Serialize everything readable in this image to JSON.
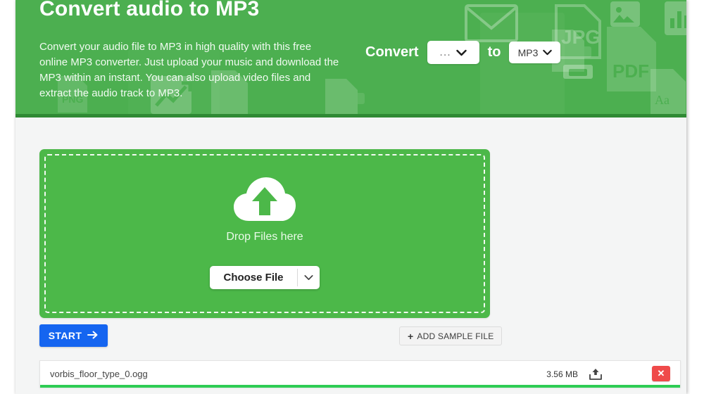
{
  "hero": {
    "title": "Convert audio to MP3",
    "description": "Convert your audio file to MP3 in high quality with this free online MP3 converter. Just upload your music and download the MP3 within an instant. You can also upload video files and extract the audio track to MP3.",
    "convert_label": "Convert",
    "to_label": "to",
    "source_format": "...",
    "target_format": "MP3",
    "brand_green": "#4caf50",
    "deco_icons": [
      "envelope-icon",
      "jpg-file-icon",
      "image-file-icon",
      "bar-chart-file-icon",
      "pdf-file-icon",
      "printer-icon",
      "png-file-icon",
      "line-chart-icon",
      "doc-file-icon",
      "text-file-icon",
      "aa-font-file-icon"
    ]
  },
  "dropzone": {
    "icon": "cloud-upload-icon",
    "text": "Drop Files here",
    "choose_file_label": "Choose File",
    "dropzone_green": "#4cb849"
  },
  "actions": {
    "start_label": "START",
    "start_icon": "arrow-right-icon",
    "start_color": "#1565f0",
    "add_sample_label": "ADD SAMPLE FILE",
    "add_sample_icon": "plus-icon"
  },
  "file_row": {
    "name": "vorbis_floor_type_0.ogg",
    "size": "3.56 MB",
    "upload_icon": "upload-tray-icon",
    "remove_icon": "close-icon",
    "remove_color": "#ef4a4a",
    "progress_percent": 100,
    "progress_color": "#2ecc54"
  }
}
